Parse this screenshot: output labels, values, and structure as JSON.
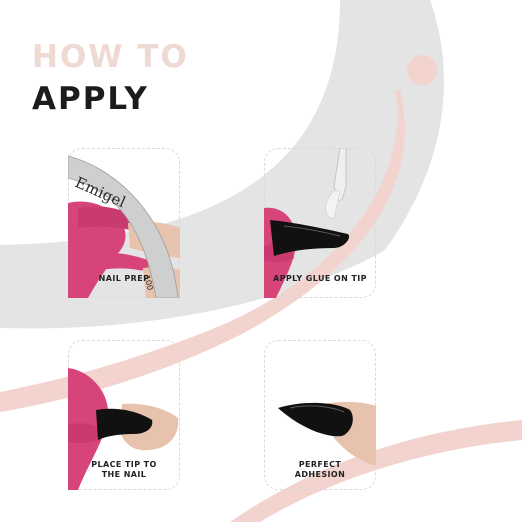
{
  "heading": {
    "line1": "HOW TO",
    "line2": "APPLY"
  },
  "steps": [
    {
      "caption": "NAIL PREP",
      "file_brand": "Emigel",
      "file_grit": "100"
    },
    {
      "caption": "APPLY GLUE ON TIP"
    },
    {
      "caption": "PLACE TIP TO\nTHE NAIL"
    },
    {
      "caption": "PERFECT\nADHESION"
    }
  ],
  "colors": {
    "heading_line1": "#efd9d3",
    "heading_line2": "#1c1c1c",
    "arc_gray": "#e4e4e4",
    "arc_pink": "#f2d3cd",
    "glove_pink": "#d7447a",
    "nail_black": "#111111",
    "skin": "#e7c3ad"
  }
}
